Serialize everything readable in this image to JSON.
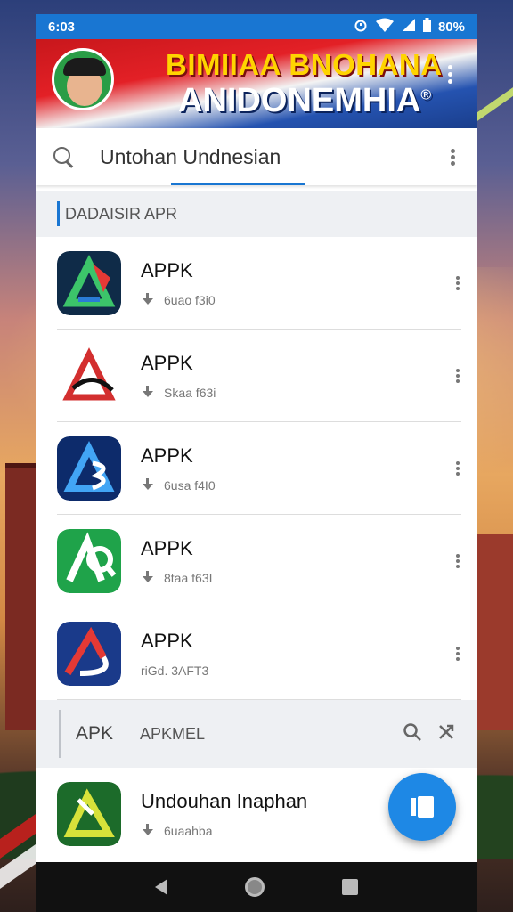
{
  "status_bar": {
    "left_text": "6:03",
    "right_text": "80%",
    "icons": [
      "alarm-icon",
      "wifi-icon",
      "signal-icon",
      "battery-icon"
    ]
  },
  "banner": {
    "title_line1": "BIMIIAA BNOHANA",
    "title_line2": "ANIDONEMHIA",
    "registered_mark": "®",
    "menu_icon": "kebab-menu-icon"
  },
  "search": {
    "value": "Untohan Undnesian",
    "icon": "search-icon"
  },
  "section1": {
    "label": "DADAISIR APR"
  },
  "apps": [
    {
      "name": "APPK",
      "meta": "6uao f3i0"
    },
    {
      "name": "APPK",
      "meta": "Skaa f63i"
    },
    {
      "name": "APPK",
      "meta": "6usa f4I0"
    },
    {
      "name": "APPK",
      "meta": "8taa f63I"
    },
    {
      "name": "APPK",
      "meta": "riGd. 3AFT3"
    }
  ],
  "section2": {
    "label_left": "APK",
    "label_right": "APKMEL",
    "icons": [
      "search-icon",
      "share-icon"
    ]
  },
  "featured_app": {
    "name": "Undouhan Inaphan",
    "meta": "6uaahba"
  },
  "colors": {
    "accent": "#1976d2",
    "fab": "#1e88e5",
    "banner_red": "#e32026",
    "banner_blue": "#2553b0",
    "title_yellow": "#ffd400"
  }
}
